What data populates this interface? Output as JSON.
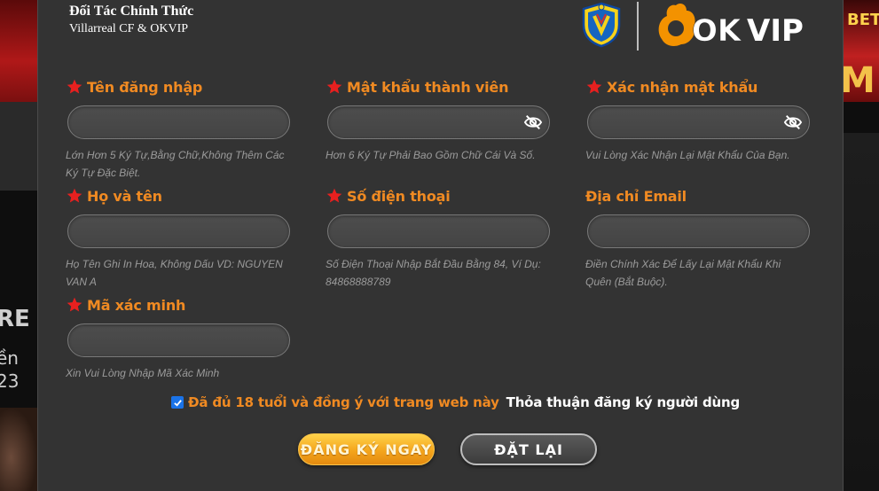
{
  "background": {
    "left_texts": [
      "RE",
      "ền",
      "23"
    ],
    "right_top_text": "BET",
    "right_big_text": "M"
  },
  "header": {
    "partner_title": "Đối Tác Chính Thức",
    "partner_subtitle": "Villarreal CF & OKVIP",
    "brand_logo_text": "OKVIP"
  },
  "fields": {
    "username": {
      "label": "Tên đăng nhập",
      "required": true,
      "value": "",
      "hint": "Lớn Hơn 5 Ký Tự,Bằng Chữ,Không Thêm Các Ký Tự Đặc Biệt."
    },
    "password": {
      "label": "Mật khẩu thành viên",
      "required": true,
      "value": "",
      "hint": "Hơn 6 Ký Tự Phải Bao Gồm Chữ Cái Và Số."
    },
    "confirm_password": {
      "label": "Xác nhận mật khẩu",
      "required": true,
      "value": "",
      "hint": "Vui Lòng Xác Nhận Lại Mật Khẩu Của Bạn."
    },
    "fullname": {
      "label": "Họ và tên",
      "required": true,
      "value": "",
      "hint": "Họ Tên Ghi In Hoa, Không Dấu VD: NGUYEN VAN A"
    },
    "phone": {
      "label": "Số điện thoại",
      "required": true,
      "value": "",
      "hint": "Số Điện Thoại Nhập Bắt Đầu Bằng 84, Ví Dụ: 84868888789"
    },
    "email": {
      "label": "Địa chỉ Email",
      "required": false,
      "value": "",
      "hint": "Điền Chính Xác Để Lấy Lại Mật Khẩu Khi Quên (Bắt Buộc)."
    },
    "captcha": {
      "label": "Mã xác minh",
      "required": true,
      "value": "",
      "hint": "Xin Vui Lòng Nhập Mã Xác Minh"
    }
  },
  "agreement": {
    "checked": true,
    "text": "Đã đủ 18 tuổi và đồng ý với trang web này",
    "link_text": "Thỏa thuận đăng ký người dùng"
  },
  "buttons": {
    "register": "ĐĂNG KÝ NGAY",
    "reset": "ĐẶT LẠI"
  },
  "colors": {
    "accent": "#f08a22",
    "star": "#e8201f",
    "modal_bg": "#333333",
    "input_bg": "#474747",
    "hint": "#9b9b9b",
    "checkbox": "#1a73e8"
  },
  "icons": {
    "required": "star-icon",
    "toggle_password": "eye-off-icon",
    "checkbox": "check-icon"
  }
}
